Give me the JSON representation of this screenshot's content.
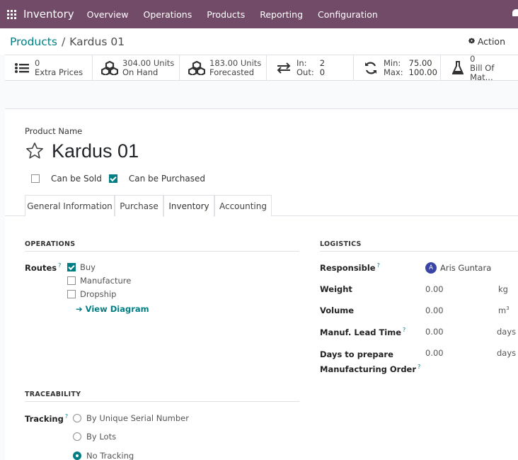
{
  "topbar": {
    "app_name": "Inventory",
    "menu": [
      "Overview",
      "Operations",
      "Products",
      "Reporting",
      "Configuration"
    ]
  },
  "breadcrumb": {
    "parent": "Products",
    "separator": "/",
    "current": "Kardus 01"
  },
  "action_label": "Action",
  "stats": {
    "extra_prices": {
      "value": "0",
      "label": "Extra Prices"
    },
    "on_hand": {
      "value": "304.00 Units",
      "label": "On Hand"
    },
    "forecasted": {
      "value": "183.00 Units",
      "label": "Forecasted"
    },
    "in_out": {
      "in_label": "In:",
      "in_value": "2",
      "out_label": "Out:",
      "out_value": "0"
    },
    "minmax": {
      "min_label": "Min:",
      "min_value": "75.00",
      "max_label": "Max:",
      "max_value": "100.00"
    },
    "bom": {
      "value": "0",
      "label": "Bill Of Mat..."
    }
  },
  "product": {
    "name_label": "Product Name",
    "name": "Kardus 01",
    "can_be_sold": "Can be Sold",
    "can_be_purchased": "Can be Purchased"
  },
  "tabs": [
    "General Information",
    "Purchase",
    "Inventory",
    "Accounting"
  ],
  "operations": {
    "header": "OPERATIONS",
    "routes_label": "Routes",
    "routes": [
      "Buy",
      "Manufacture",
      "Dropship"
    ],
    "view_diagram": "View Diagram"
  },
  "logistics": {
    "header": "LOGISTICS",
    "responsible_label": "Responsible",
    "responsible_initial": "A",
    "responsible": "Aris Guntara",
    "weight_label": "Weight",
    "weight": "0.00",
    "weight_unit": "kg",
    "volume_label": "Volume",
    "volume": "0.00",
    "volume_unit": "m",
    "volume_unit_exp": "3",
    "lead_label": "Manuf. Lead Time",
    "lead": "0.00",
    "lead_unit": "days",
    "prep_label_1": "Days to prepare",
    "prep_label_2": "Manufacturing Order",
    "prep": "0.00",
    "prep_unit": "days"
  },
  "traceability": {
    "header": "TRACEABILITY",
    "tracking_label": "Tracking",
    "options": [
      "By Unique Serial Number",
      "By Lots",
      "No Tracking"
    ]
  },
  "help_mark": "?",
  "colors": {
    "brand": "#714b67",
    "accent": "#017e84"
  }
}
